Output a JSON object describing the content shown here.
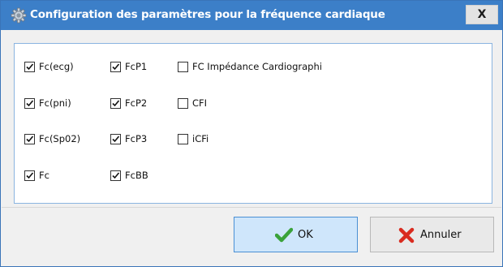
{
  "dialog": {
    "title": "Configuration des paramètres pour la fréquence cardiaque",
    "close_label": "X"
  },
  "checkboxes": {
    "col1": [
      {
        "label": "Fc(ecg)",
        "checked": true
      },
      {
        "label": "Fc(pni)",
        "checked": true
      },
      {
        "label": "Fc(Sp02)",
        "checked": true
      },
      {
        "label": "Fc",
        "checked": true
      }
    ],
    "col2": [
      {
        "label": "FcP1",
        "checked": true
      },
      {
        "label": "FcP2",
        "checked": true
      },
      {
        "label": "FcP3",
        "checked": true
      },
      {
        "label": "FcBB",
        "checked": true
      }
    ],
    "col3": [
      {
        "label": "FC Impédance Cardiographi",
        "checked": false
      },
      {
        "label": "CFI",
        "checked": false
      },
      {
        "label": "iCFi",
        "checked": false
      }
    ]
  },
  "buttons": {
    "ok_label": "OK",
    "cancel_label": "Annuler"
  },
  "colors": {
    "titlebar": "#3c7fc8",
    "ok_check": "#3aa23a",
    "cancel_x": "#d92b1f"
  }
}
